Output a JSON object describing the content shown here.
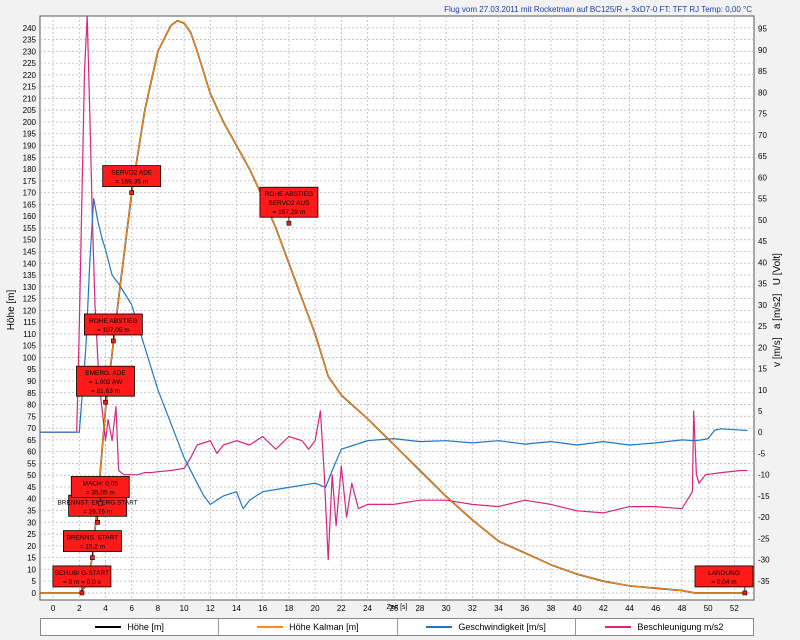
{
  "chart_data": {
    "type": "line",
    "title": "Flug vom 27.03.2011 mit Rocketman auf BC125/R + 3xD7-0 FT: TFT RJ Temp: 0,00 °C",
    "xlabel": "Zeit [s]",
    "ylabel": "Höhe [m]",
    "y2label": "v [m/s]   a [m/s2]   U [Volt]",
    "xlim": [
      -1,
      53.5
    ],
    "ylim": [
      -3,
      245
    ],
    "y2lim": [
      -39.5,
      98
    ],
    "grid": true,
    "legend_placement": "bottom",
    "x_ticks": [
      0,
      2,
      4,
      6,
      8,
      10,
      12,
      14,
      16,
      18,
      20,
      22,
      24,
      26,
      28,
      30,
      32,
      34,
      36,
      38,
      40,
      42,
      44,
      46,
      48,
      50,
      52
    ],
    "y_ticks": [
      0,
      5,
      10,
      15,
      20,
      25,
      30,
      35,
      40,
      45,
      50,
      55,
      60,
      65,
      70,
      75,
      80,
      85,
      90,
      95,
      100,
      105,
      110,
      115,
      120,
      125,
      130,
      135,
      140,
      145,
      150,
      155,
      160,
      165,
      170,
      175,
      180,
      185,
      190,
      195,
      200,
      205,
      210,
      215,
      220,
      225,
      230,
      235,
      240
    ],
    "y2_ticks": [
      -35,
      -30,
      -25,
      -20,
      -15,
      -10,
      -5,
      0,
      5,
      10,
      15,
      20,
      25,
      30,
      35,
      40,
      45,
      50,
      55,
      60,
      65,
      70,
      75,
      80,
      85,
      90,
      95
    ],
    "series": [
      {
        "name": "Höhe [m]",
        "axis": "left",
        "color": "#000000",
        "x": [
          -1,
          2.0,
          2.5,
          3.0,
          3.5,
          4.0,
          5.0,
          6.0,
          7.0,
          8.0,
          9.0,
          9.5,
          10.0,
          10.5,
          11.0,
          12.0,
          13.0,
          14.0,
          15.0,
          16.0,
          17.0,
          18.0,
          19.0,
          20.0,
          21.0,
          22.0,
          24.0,
          26.0,
          28.0,
          30.0,
          32.0,
          34.0,
          36.0,
          38.0,
          40.0,
          42.0,
          44.0,
          46.0,
          48.0,
          49.0,
          50.0,
          52.0,
          53.0
        ],
        "y": [
          0,
          0,
          3,
          15,
          45,
          78,
          125,
          170,
          205,
          230,
          241,
          243,
          242,
          238,
          230,
          212,
          200,
          190,
          180,
          168,
          155,
          140,
          125,
          110,
          92,
          84,
          74,
          63,
          52,
          41,
          31,
          22,
          17,
          12,
          8,
          5,
          3,
          2,
          1,
          0,
          0,
          0,
          0
        ]
      },
      {
        "name": "Höhe Kalman [m]",
        "axis": "left",
        "color": "#ff8c1a",
        "x": [
          -1,
          2.0,
          2.5,
          3.0,
          3.5,
          4.0,
          5.0,
          6.0,
          7.0,
          8.0,
          9.0,
          9.5,
          10.0,
          10.5,
          11.0,
          12.0,
          13.0,
          14.0,
          15.0,
          16.0,
          17.0,
          18.0,
          19.0,
          20.0,
          21.0,
          22.0,
          24.0,
          26.0,
          28.0,
          30.0,
          32.0,
          34.0,
          36.0,
          38.0,
          40.0,
          42.0,
          44.0,
          46.0,
          48.0,
          49.0,
          50.0,
          52.0,
          53.0
        ],
        "y": [
          0,
          0,
          3,
          15,
          45,
          78,
          125,
          170,
          205,
          230,
          241,
          243,
          242,
          238,
          230,
          212,
          200,
          190,
          180,
          168,
          155,
          140,
          125,
          110,
          92,
          84,
          74,
          63,
          52,
          41,
          31,
          22,
          17,
          12,
          8,
          5,
          3,
          2,
          1,
          0,
          0,
          0,
          0
        ]
      },
      {
        "name": "Geschwindigkeit [m/s]",
        "axis": "right",
        "color": "#1f77c4",
        "x": [
          -1,
          2.0,
          2.5,
          2.8,
          3.1,
          3.4,
          3.7,
          4.0,
          4.5,
          5.0,
          6.0,
          7.0,
          8.0,
          9.0,
          10.0,
          11.0,
          11.5,
          12.0,
          13.0,
          14.0,
          14.5,
          15.0,
          16.0,
          18.0,
          20.0,
          20.8,
          21.3,
          22.0,
          23.0,
          24.0,
          26.0,
          28.0,
          30.0,
          32.0,
          34.0,
          36.0,
          38.0,
          40.0,
          42.0,
          44.0,
          46.0,
          48.0,
          49.0,
          49.5,
          50.0,
          50.5,
          51.0,
          52.0,
          53.0
        ],
        "y": [
          0,
          0,
          20,
          40,
          55,
          50,
          46,
          43,
          37,
          35,
          30,
          20,
          10,
          2,
          -6,
          -12,
          -15,
          -17,
          -15,
          -14,
          -18,
          -16,
          -14,
          -13,
          -12,
          -13,
          -9,
          -4,
          -3,
          -2,
          -1.5,
          -2.2,
          -2,
          -2.5,
          -2,
          -2.8,
          -2.2,
          -3,
          -2.2,
          -3,
          -2.5,
          -1.8,
          -2,
          -1.8,
          -1.5,
          0.5,
          0.8,
          0.6,
          0.4
        ]
      },
      {
        "name": "Beschleunigung m/s2",
        "axis": "right",
        "color": "#d6267f",
        "x": [
          -1,
          1.8,
          2.0,
          2.2,
          2.4,
          2.6,
          2.8,
          3.0,
          3.2,
          3.5,
          4.0,
          4.2,
          4.5,
          4.8,
          5.0,
          5.4,
          6.0,
          6.5,
          7.0,
          7.5,
          8.0,
          9.0,
          10.0,
          10.5,
          11.0,
          12.0,
          12.5,
          13.0,
          14.0,
          15.0,
          16.0,
          17.0,
          18.0,
          19.0,
          19.5,
          20.0,
          20.4,
          20.7,
          21.0,
          21.3,
          21.6,
          22.0,
          22.4,
          22.8,
          23.3,
          24.0,
          26.0,
          28.0,
          30.0,
          32.0,
          34.0,
          36.0,
          38.0,
          40.0,
          42.0,
          44.0,
          46.0,
          48.0,
          48.8,
          48.9,
          49.1,
          49.3,
          49.8,
          51.0,
          52.5,
          53.0
        ],
        "y": [
          0,
          0,
          25,
          55,
          85,
          98,
          75,
          50,
          30,
          12,
          -2,
          3,
          -2,
          6,
          -9,
          -10,
          -10,
          -10,
          -9.5,
          -9.5,
          -9.3,
          -9,
          -8.5,
          -6,
          -3,
          -2,
          -5,
          -3,
          -2,
          -3,
          -1,
          -4,
          -1,
          -2,
          -4,
          -2,
          5,
          -10,
          -30,
          -10,
          -22,
          -8,
          -20,
          -12,
          -18,
          -17,
          -17,
          -16,
          -16,
          -17,
          -17.5,
          -16,
          -17,
          -18.5,
          -19,
          -17.5,
          -17.5,
          -18,
          -14,
          5,
          -10,
          -12,
          -10,
          -9.5,
          -9,
          -9
        ]
      }
    ],
    "annotations": [
      {
        "lines": [
          "SCHUB/ G-START",
          "= 0 m  = 0,0 s"
        ],
        "x": 2.2,
        "y": 0
      },
      {
        "lines": [
          "BRENNS. START",
          "= 15,2 m"
        ],
        "x": 3.0,
        "y": 15
      },
      {
        "lines": [
          "BRENNST. EMERG.START",
          "= 26,76 m"
        ],
        "x": 3.4,
        "y": 30
      },
      {
        "lines": [
          "MACH: 0,05",
          "= 35,05 m"
        ],
        "x": 3.6,
        "y": 38
      },
      {
        "lines": [
          "EMERG. ADE",
          "= 1.002 AW",
          "= 81,63 m"
        ],
        "x": 4.0,
        "y": 81
      },
      {
        "lines": [
          "ROHE ABSTIEG",
          "= 107,05 m"
        ],
        "x": 4.6,
        "y": 107
      },
      {
        "lines": [
          "SERVO2 ADE",
          "= 169,35 m"
        ],
        "x": 6.0,
        "y": 170
      },
      {
        "lines": [
          "ROHE ABSTIEG",
          "SERVO2 AUS",
          "= 157,29 m"
        ],
        "x": 18.0,
        "y": 157
      },
      {
        "lines": [
          "LANDUNG",
          "= 0,04 m"
        ],
        "x": 52.8,
        "y": 0
      }
    ]
  }
}
